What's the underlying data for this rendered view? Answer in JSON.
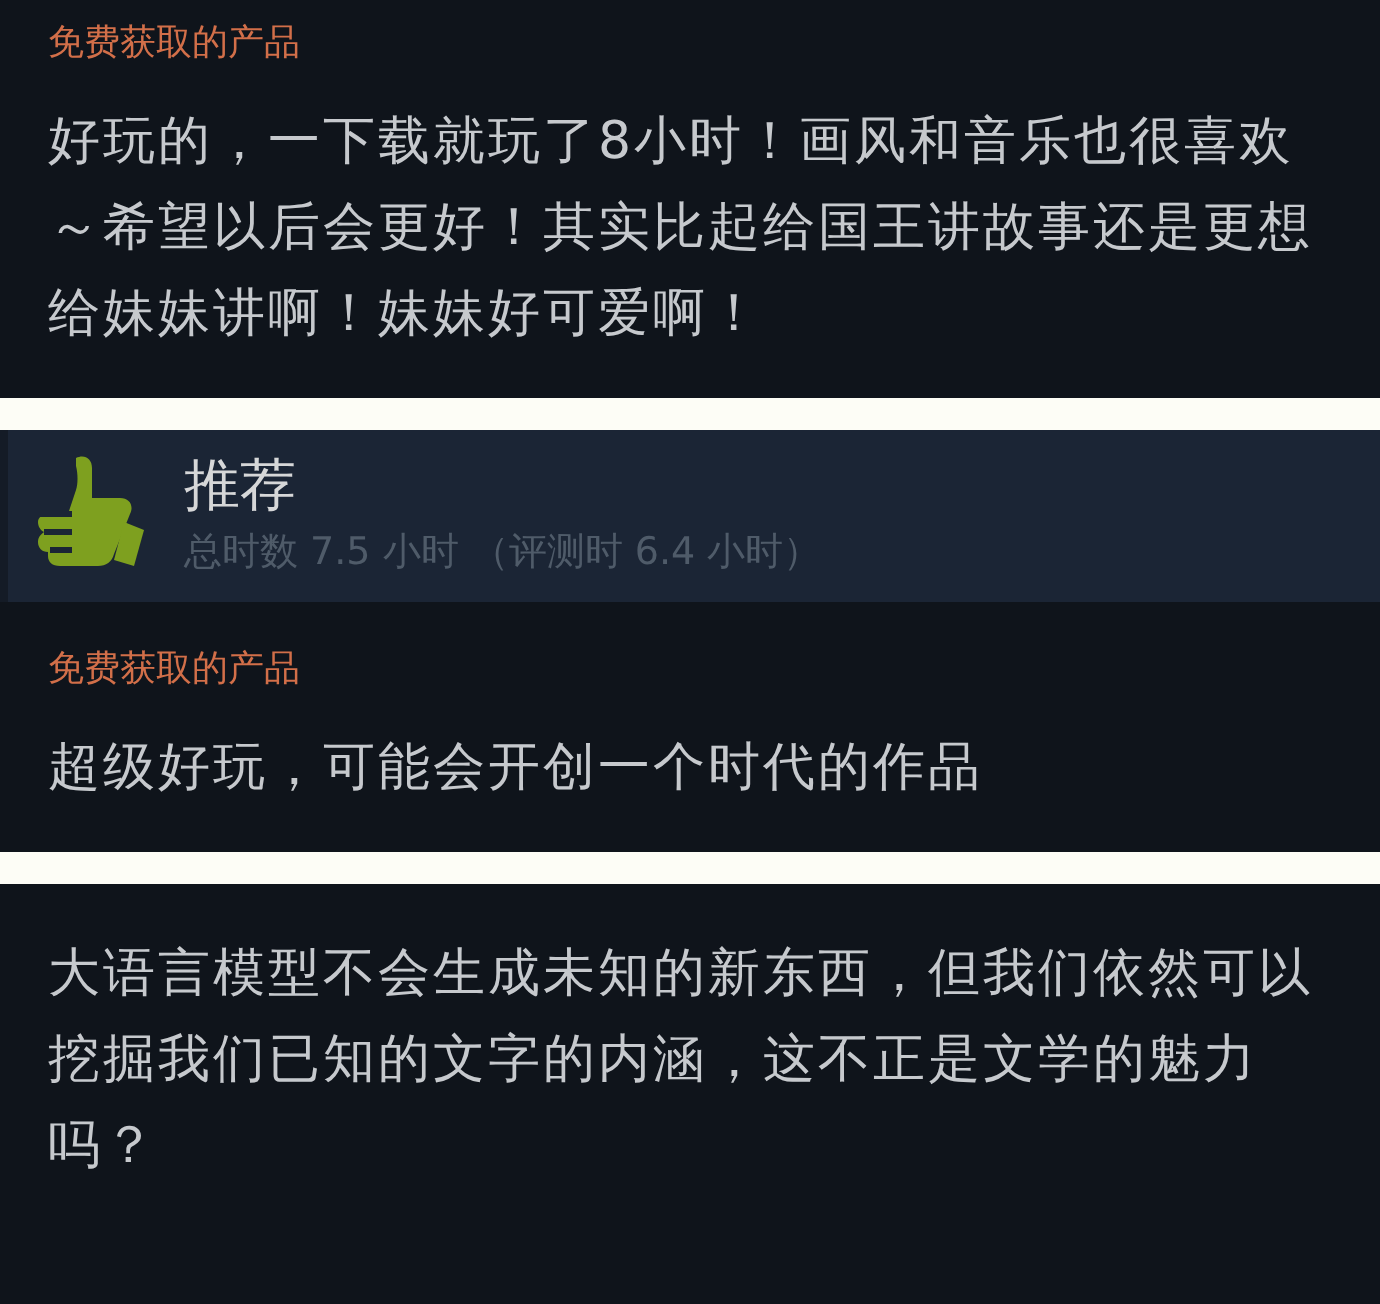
{
  "reviews": [
    {
      "acquisition_note": "免费获取的产品",
      "text": "好玩的，一下载就玩了8小时！画风和音乐也很喜欢～希望以后会更好！其实比起给国王讲故事还是更想给妹妹讲啊！妹妹好可爱啊！"
    },
    {
      "header": {
        "recommended": true,
        "verdict": "推荐",
        "hours": "总时数 7.5 小时 （评测时 6.4 小时）"
      },
      "acquisition_note": "免费获取的产品",
      "text": "超级好玩，可能会开创一个时代的作品"
    },
    {
      "text": "大语言模型不会生成未知的新东西，但我们依然可以挖掘我们已知的文字的内涵，这不正是文学的魅力吗？"
    }
  ]
}
